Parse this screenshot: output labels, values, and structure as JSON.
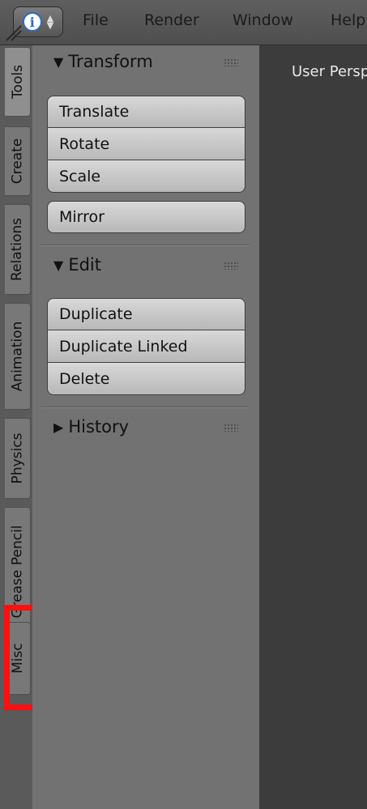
{
  "menubar": {
    "items": [
      "File",
      "Render",
      "Window",
      "Help"
    ]
  },
  "tabs": [
    {
      "label": "Tools",
      "active": true
    },
    {
      "label": "Create",
      "active": false
    },
    {
      "label": "Relations",
      "active": false
    },
    {
      "label": "Animation",
      "active": false
    },
    {
      "label": "Physics",
      "active": false
    },
    {
      "label": "Grease Pencil",
      "active": false
    },
    {
      "label": "Misc",
      "active": false
    }
  ],
  "panels": {
    "transform": {
      "title": "Transform",
      "buttons": [
        "Translate",
        "Rotate",
        "Scale"
      ],
      "mirror": "Mirror"
    },
    "edit": {
      "title": "Edit",
      "buttons": [
        "Duplicate",
        "Duplicate Linked",
        "Delete"
      ]
    },
    "history": {
      "title": "History"
    }
  },
  "viewport": {
    "label": "User Persp"
  },
  "colors": {
    "highlight": "#ff1010",
    "viewport_bg": "#3c3c3c",
    "shelf_bg": "#727272"
  }
}
